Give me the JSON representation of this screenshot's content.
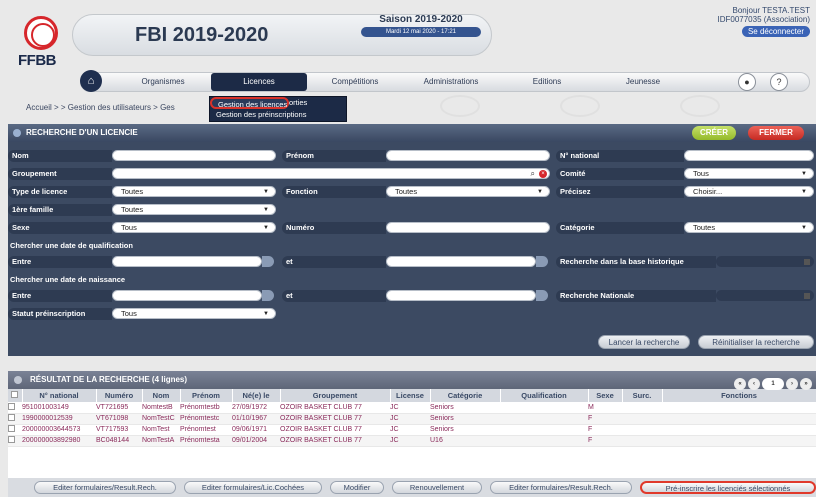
{
  "header": {
    "logo_text": "FFBB",
    "title": "FBI 2019-2020",
    "season_label": "Saison 2019-2020",
    "season_date": "Mardi 12 mai 2020 - 17:21",
    "user_greeting": "Bonjour TESTA.TEST",
    "user_id": "IDF0077035 (Association)",
    "logout_label": "Se déconnecter"
  },
  "nav": {
    "home_icon": "home-icon",
    "items": [
      "Organismes",
      "Licences",
      "Compétitions",
      "Administrations",
      "Editions",
      "Jeunesse"
    ],
    "active": "Licences",
    "help_label": "?"
  },
  "dropdown": {
    "items": [
      "Gestion des licences",
      "Gestion des entrées/sorties",
      "Gestion des préinscriptions"
    ],
    "selected": "Gestion des licences"
  },
  "breadcrumb": "Accueil > > Gestion des utilisateurs > Ges",
  "search_panel": {
    "title": "RECHERCHE D'UN LICENCIE",
    "create_label": "CRÉER",
    "close_label": "FERMER",
    "fields": {
      "nom": "Nom",
      "prenom": "Prénom",
      "num_national": "N° national",
      "groupement": "Groupement",
      "comite": "Comité",
      "comite_value": "Tous",
      "type_licence": "Type de licence",
      "type_licence_value": "Toutes",
      "fonction": "Fonction",
      "fonction_value": "Toutes",
      "precisez": "Précisez",
      "precisez_value": "Choisir...",
      "premiere_famille": "1ère famille",
      "premiere_famille_value": "Toutes",
      "sexe": "Sexe",
      "sexe_value": "Tous",
      "numero": "Numéro",
      "categorie": "Catégorie",
      "categorie_value": "Toutes",
      "qualif_section": "Chercher une date de qualification",
      "entre": "Entre",
      "et": "et",
      "base_historique": "Recherche dans la base historique",
      "naissance_section": "Chercher une date de naissance",
      "entre2": "Entre",
      "et2": "et",
      "recherche_nationale": "Recherche Nationale",
      "statut": "Statut préinscription",
      "statut_value": "Tous"
    },
    "launch_label": "Lancer la recherche",
    "reset_label": "Réinitialiser la recherche"
  },
  "results": {
    "title": "RÉSULTAT DE LA RECHERCHE (4 lignes)",
    "page": "1",
    "columns": [
      "",
      "N° national",
      "Numéro",
      "Nom",
      "Prénom",
      "Né(e) le",
      "Groupement",
      "License",
      "Catégorie",
      "Qualification",
      "Sexe",
      "Surc.",
      "Fonctions"
    ],
    "rows": [
      [
        "",
        "951001003149",
        "VT721695",
        "NomtestB",
        "Prénomtestb",
        "27/09/1972",
        "OZOIR BASKET CLUB 77",
        "JC",
        "Seniors",
        "",
        "M",
        "",
        ""
      ],
      [
        "",
        "1990000012539",
        "VT671098",
        "NomTestC",
        "Prénomtestc",
        "01/10/1967",
        "OZOIR BASKET CLUB 77",
        "JC",
        "Seniors",
        "",
        "F",
        "",
        ""
      ],
      [
        "",
        "200000003644573",
        "VT717593",
        "NomTest",
        "Prénomtest",
        "09/06/1971",
        "OZOIR BASKET CLUB 77",
        "JC",
        "Seniors",
        "",
        "F",
        "",
        ""
      ],
      [
        "",
        "200000003892980",
        "BC048144",
        "NomTestA",
        "Prénomtesta",
        "09/01/2004",
        "OZOIR BASKET CLUB 77",
        "JC",
        "U16",
        "",
        "F",
        "",
        ""
      ]
    ]
  },
  "footer": {
    "buttons": [
      "Editer formulaires/Result.Rech.",
      "Editer formulaires/Lic.Cochées",
      "Modifier",
      "Renouvellement",
      "Editer formulaires/Result.Rech.",
      "Pré-inscrire les licenciés sélectionnés"
    ]
  }
}
